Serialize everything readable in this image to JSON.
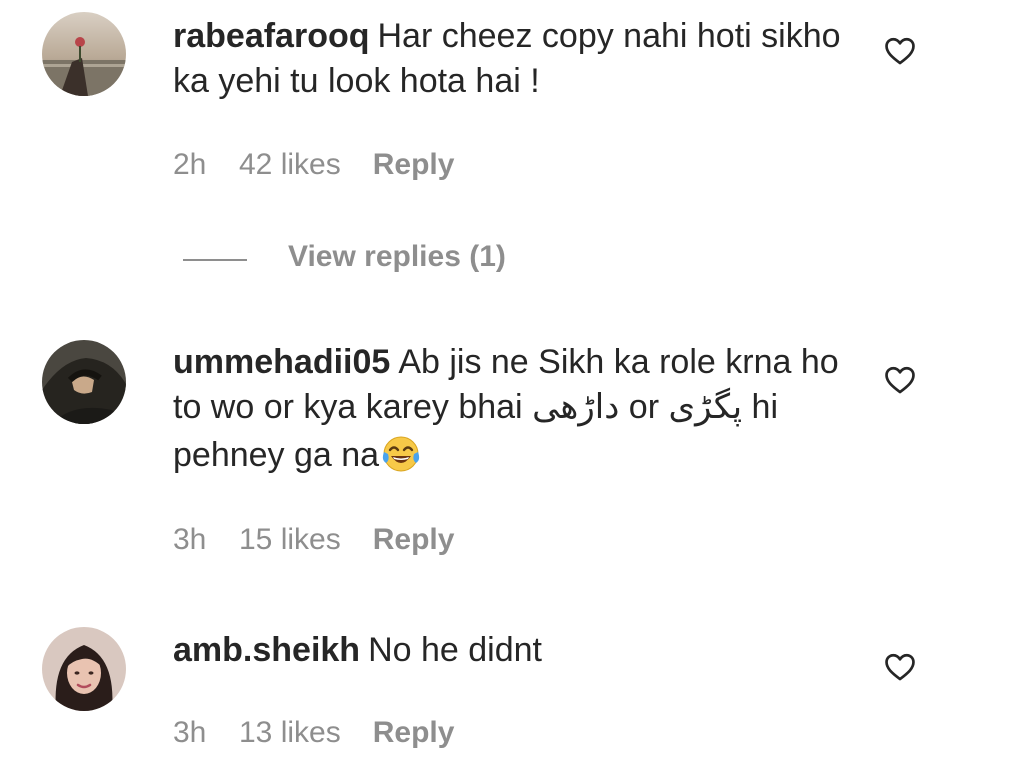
{
  "comments": [
    {
      "username": "rabeafarooq",
      "text": "Har cheez copy nahi hoti sikho ka yehi tu look hota hai !",
      "time": "2h",
      "likes": "42 likes",
      "reply_label": "Reply",
      "view_replies": "View replies (1)"
    },
    {
      "username": "ummehadii05",
      "text_before": "Ab jis ne Sikh ka role krna ho to wo or kya karey bhai ",
      "urdu_1": "داڑھی",
      "text_mid": " or ",
      "urdu_2": "پگڑی",
      "text_after": " hi pehney ga na",
      "emoji": "tears-of-joy-emoji",
      "time": "3h",
      "likes": "15 likes",
      "reply_label": "Reply"
    },
    {
      "username": "amb.sheikh",
      "text": "No he didnt",
      "time": "3h",
      "likes": "13 likes",
      "reply_label": "Reply"
    }
  ],
  "icons": {
    "like": "heart-outline-icon"
  },
  "colors": {
    "primary_text": "#262626",
    "secondary_text": "#8e8e8e",
    "background": "#ffffff"
  }
}
